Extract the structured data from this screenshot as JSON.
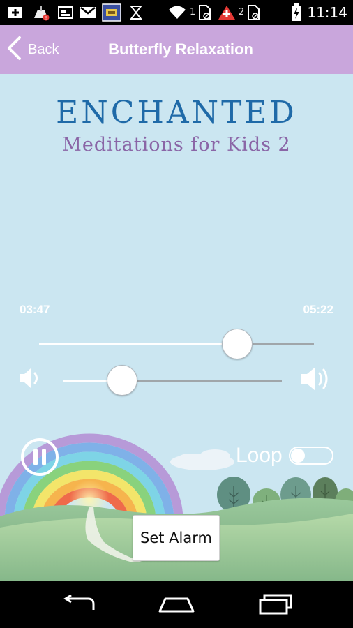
{
  "status_bar": {
    "sim1_count": "1",
    "sim2_count": "2",
    "time": "11:14",
    "icons": [
      "android-debug-icon",
      "cleaner-icon",
      "image-icon",
      "gmail-icon",
      "game-icon",
      "wait-icon",
      "wifi-icon",
      "sim-card-icon",
      "alert-icon",
      "sim-card-icon",
      "battery-charging-icon"
    ]
  },
  "app_bar": {
    "back_label": "Back",
    "title": "Butterfly Relaxation",
    "background": "#c9a6dc"
  },
  "brand": {
    "title": "ENCHANTED",
    "subtitle": "Meditations for Kids 2"
  },
  "player": {
    "elapsed": "03:47",
    "total": "05:22",
    "progress_fraction": 0.72,
    "volume_fraction": 0.27,
    "state": "playing",
    "pause_icon": "pause-icon"
  },
  "loop": {
    "label": "Loop",
    "enabled": false
  },
  "alarm": {
    "button_label": "Set Alarm"
  },
  "nav_bar": {
    "icons": [
      "back-nav-icon",
      "home-nav-icon",
      "recent-apps-icon"
    ]
  },
  "colors": {
    "content_bg": "#cbe6f1",
    "brand_title": "#1f6aa8",
    "brand_subtitle": "#8a65a6"
  }
}
